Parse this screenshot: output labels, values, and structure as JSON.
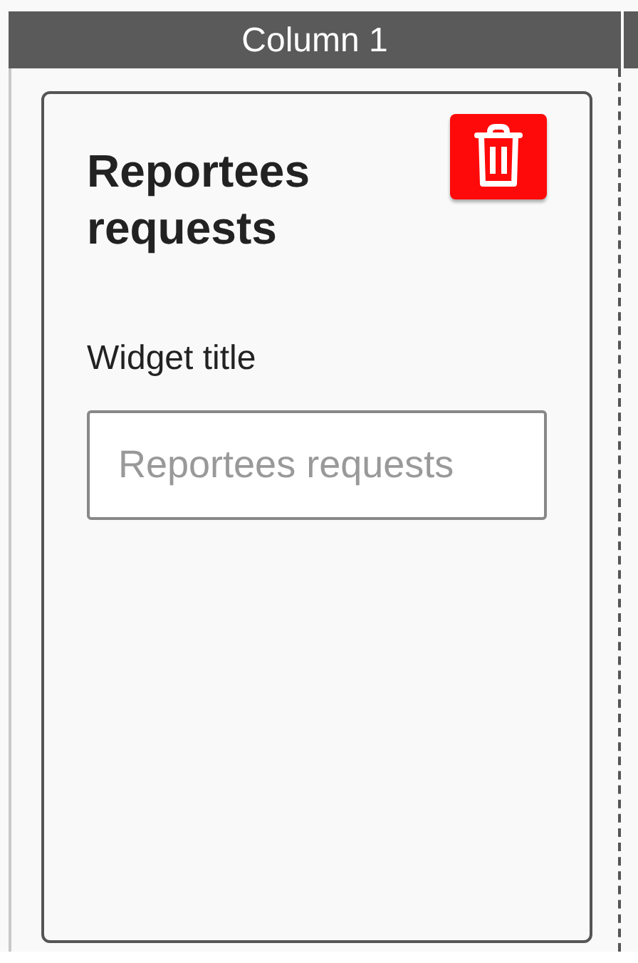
{
  "columns": [
    {
      "title": "Column 1",
      "widgets": [
        {
          "title": "Reportees requests",
          "fields": [
            {
              "label": "Widget title",
              "placeholder": "Reportees requests"
            }
          ]
        }
      ]
    }
  ]
}
